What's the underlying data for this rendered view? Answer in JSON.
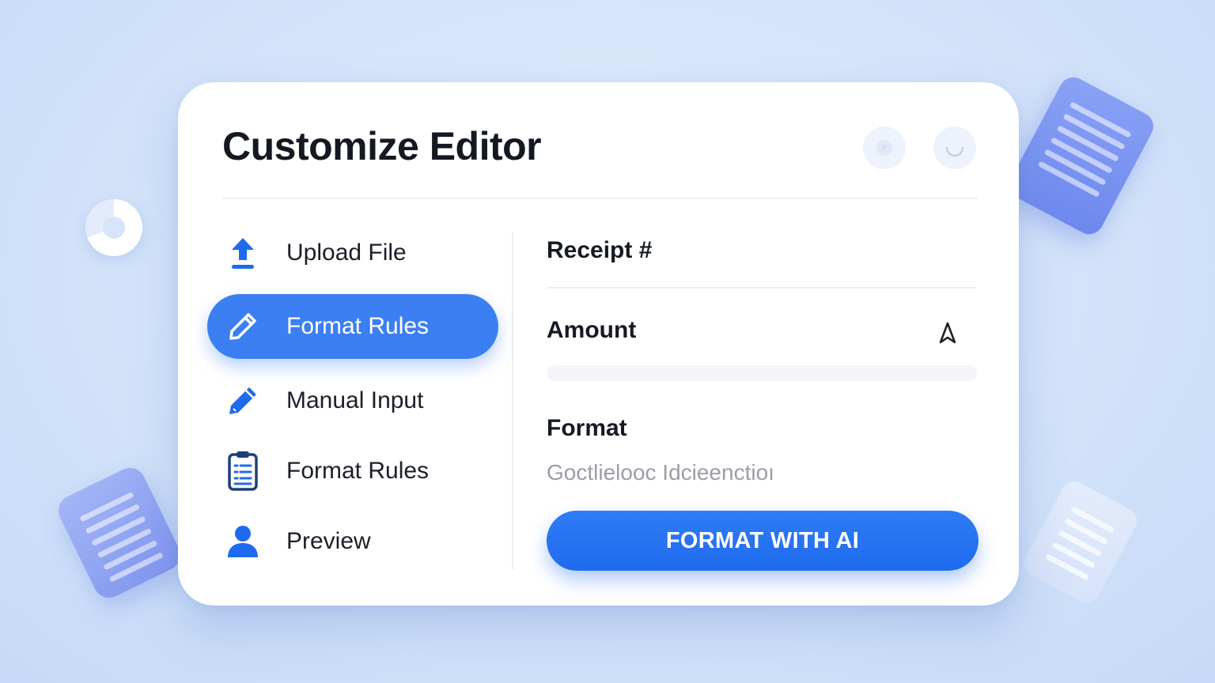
{
  "colors": {
    "accent": "#3b7ff3",
    "button": "#1f6bef",
    "icon": "#1f6bef",
    "background": "#d6e5fa"
  },
  "editor": {
    "title": "Customize Editor",
    "header_buttons": [
      "settings-icon",
      "refresh-icon"
    ]
  },
  "sidebar": {
    "items": [
      {
        "label": "Upload File",
        "icon": "upload-icon",
        "active": false
      },
      {
        "label": "Format Rules",
        "icon": "pencil-icon",
        "active": true
      },
      {
        "label": "Manual Input",
        "icon": "pen-icon",
        "active": false
      },
      {
        "label": "Format Rules",
        "icon": "clipboard-list-icon",
        "active": false
      },
      {
        "label": "Preview",
        "icon": "user-icon",
        "active": false
      }
    ]
  },
  "form": {
    "receipt_label": "Receipt #",
    "amount_label": "Amount",
    "amount_icon": "cursor-icon",
    "format_label": "Format",
    "format_value": "Goctlielooc Idcieenctioı",
    "submit_label": "FORMAT WITH AI"
  }
}
